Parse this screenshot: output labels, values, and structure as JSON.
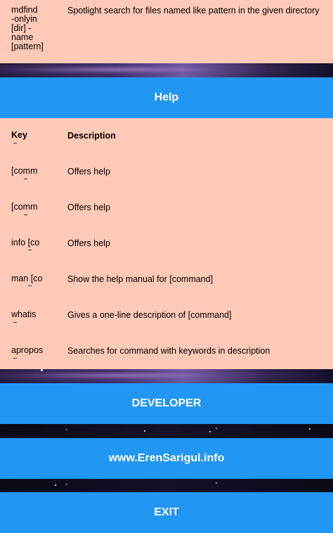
{
  "top_row": {
    "key": "mdfind\n-onlyin\n[dir] -\nname\n[pattern]",
    "description": "Spotlight search for files named like pattern in the given directory"
  },
  "help_header": "Help",
  "table": {
    "headers": {
      "key": "Key",
      "description": "Description"
    },
    "rows": [
      {
        "key": "[comm",
        "description": "Offers help"
      },
      {
        "key": "[comm",
        "description": "Offers help"
      },
      {
        "key": "info [co",
        "description": "Offers help"
      },
      {
        "key": "man [co",
        "description": "Show the help manual for [command]"
      },
      {
        "key": "whatis",
        "description": "Gives a one-line description of [command]"
      },
      {
        "key": "apropos",
        "description": "Searches for command with keywords in description"
      }
    ]
  },
  "buttons": {
    "developer": "DEVELOPER",
    "website": "www.ErenSarigul.info",
    "exit": "EXIT"
  },
  "colors": {
    "accent": "#2196f3",
    "panel": "#ffc9b8"
  }
}
